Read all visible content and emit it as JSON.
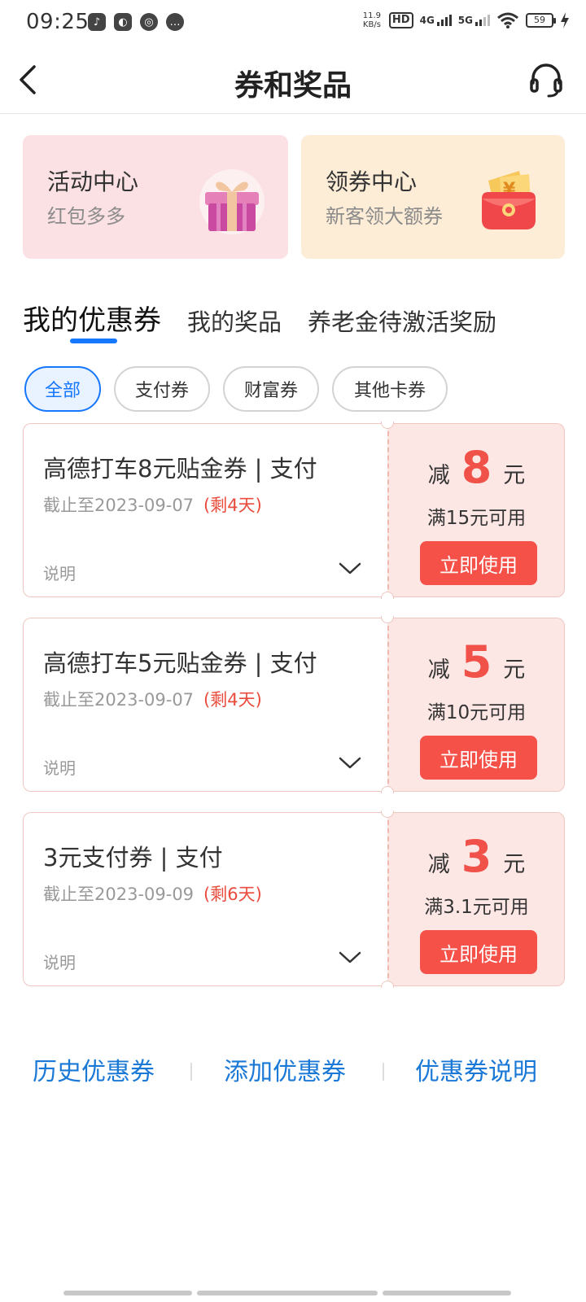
{
  "status_bar": {
    "time": "09:25",
    "speed_top": "11.9",
    "speed_bottom": "KB/s",
    "hd": "HD",
    "net1": "4G",
    "net2": "5G",
    "battery": "59"
  },
  "header": {
    "title": "券和奖品"
  },
  "promos": [
    {
      "title": "活动中心",
      "subtitle": "红包多多",
      "icon": "gift-box-icon"
    },
    {
      "title": "领券中心",
      "subtitle": "新客领大额券",
      "icon": "red-envelope-icon"
    }
  ],
  "tabs": [
    "我的优惠券",
    "我的奖品",
    "养老金待激活奖励"
  ],
  "filters": [
    "全部",
    "支付券",
    "财富券",
    "其他卡券"
  ],
  "coupons": [
    {
      "name": "高德打车8元贴金券 | 支付",
      "expiry": "截止至2023-09-07",
      "remaining": "(剩4天)",
      "desc": "说明",
      "prefix": "减",
      "amount": "8",
      "unit": "元",
      "condition": "满15元可用",
      "button": "立即使用"
    },
    {
      "name": "高德打车5元贴金券 | 支付",
      "expiry": "截止至2023-09-07",
      "remaining": "(剩4天)",
      "desc": "说明",
      "prefix": "减",
      "amount": "5",
      "unit": "元",
      "condition": "满10元可用",
      "button": "立即使用"
    },
    {
      "name": "3元支付券 | 支付",
      "expiry": "截止至2023-09-09",
      "remaining": "(剩6天)",
      "desc": "说明",
      "prefix": "减",
      "amount": "3",
      "unit": "元",
      "condition": "满3.1元可用",
      "button": "立即使用"
    }
  ],
  "links": [
    "历史优惠券",
    "添加优惠券",
    "优惠券说明"
  ],
  "colors": {
    "accent": "#1677ff",
    "coupon_red": "#f55148",
    "link_blue": "#1a78d6"
  }
}
